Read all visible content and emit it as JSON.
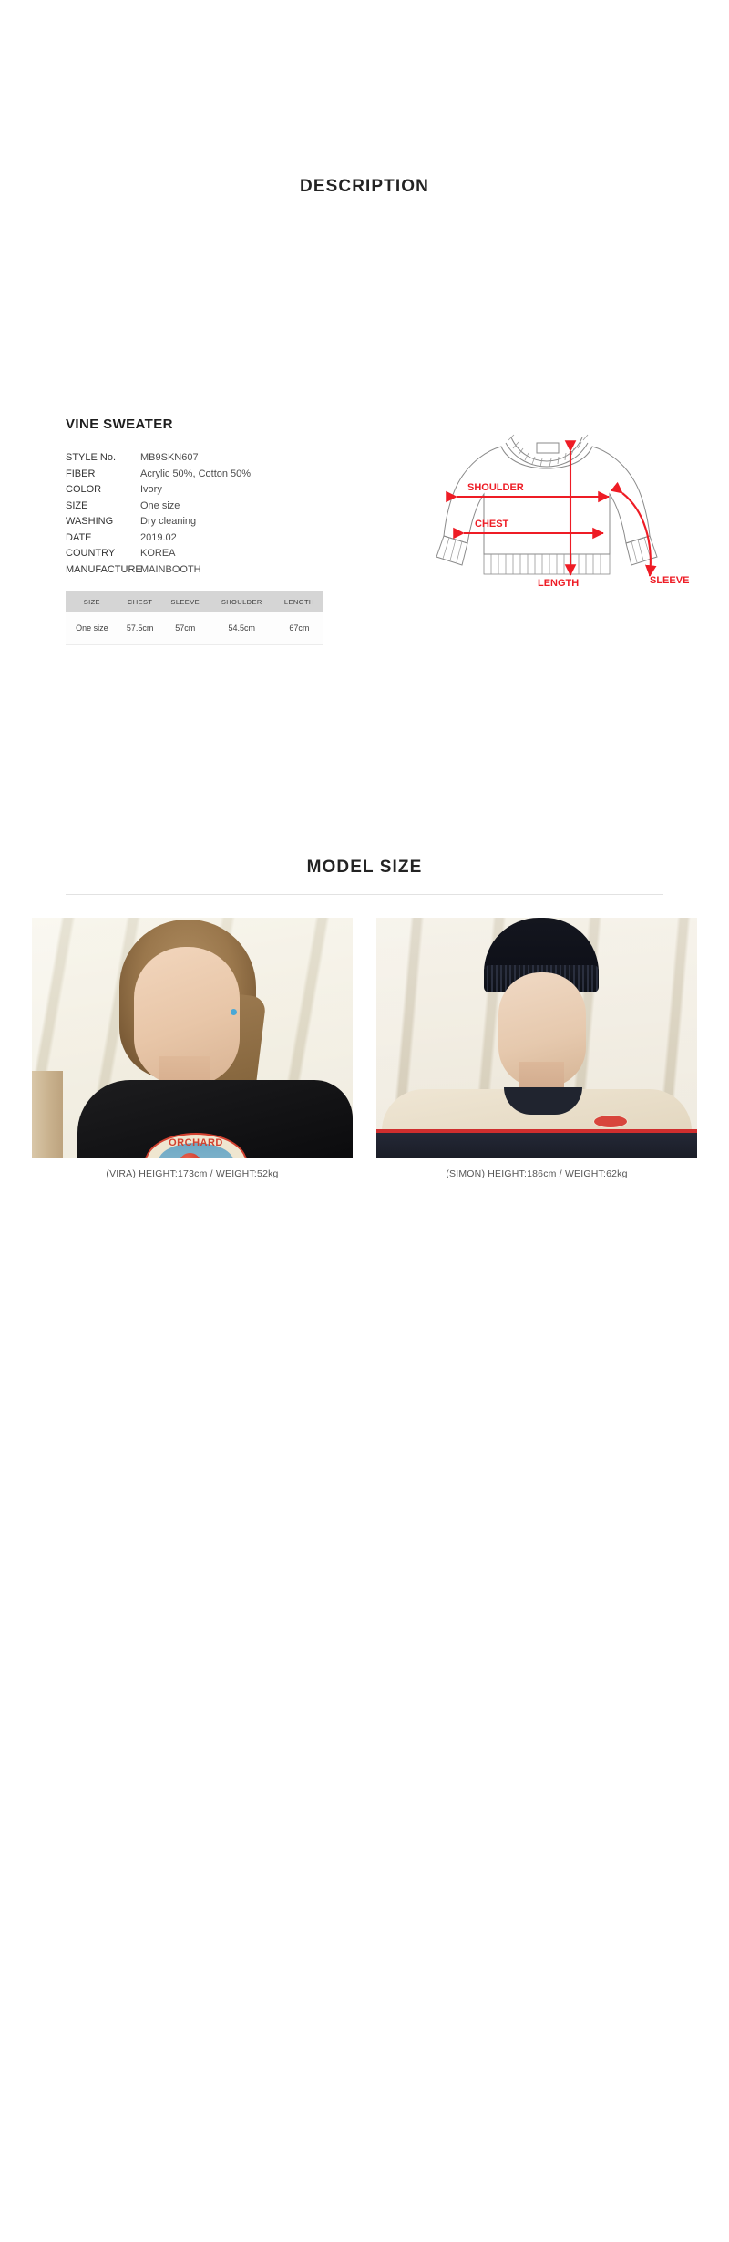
{
  "sections": {
    "description_title": "DESCRIPTION",
    "model_title": "MODEL SIZE"
  },
  "product": {
    "name": "VINE SWEATER",
    "specs": [
      {
        "key": "STYLE No.",
        "value": "MB9SKN607"
      },
      {
        "key": "FIBER",
        "value": "Acrylic 50%, Cotton 50%"
      },
      {
        "key": "COLOR",
        "value": "Ivory"
      },
      {
        "key": "SIZE",
        "value": "One size"
      },
      {
        "key": "WASHING",
        "value": "Dry cleaning"
      },
      {
        "key": "DATE",
        "value": "2019.02"
      },
      {
        "key": "COUNTRY",
        "value": "KOREA"
      },
      {
        "key": "MANUFACTURE",
        "value": "MAINBOOTH"
      }
    ]
  },
  "size_table": {
    "headers": [
      "SIZE",
      "CHEST",
      "SLEEVE",
      "SHOULDER",
      "LENGTH"
    ],
    "rows": [
      [
        "One size",
        "57.5cm",
        "57cm",
        "54.5cm",
        "67cm"
      ]
    ]
  },
  "diagram": {
    "labels": {
      "shoulder": "SHOULDER",
      "chest": "CHEST",
      "length": "LENGTH",
      "sleeve": "SLEEVE"
    },
    "accent_color": "#ee1c25",
    "outline_color": "#808080"
  },
  "models": [
    {
      "caption": "(VIRA) HEIGHT:173cm / WEIGHT:52kg",
      "graphic_text": "ORCHARD"
    },
    {
      "caption": "(SIMON) HEIGHT:186cm / WEIGHT:62kg",
      "graphic_text": ""
    }
  ],
  "colors": {
    "page_background": "#ffffff",
    "heading": "#232323",
    "rule": "#e2e2e2",
    "table_header_bg": "#d5d5d5"
  }
}
